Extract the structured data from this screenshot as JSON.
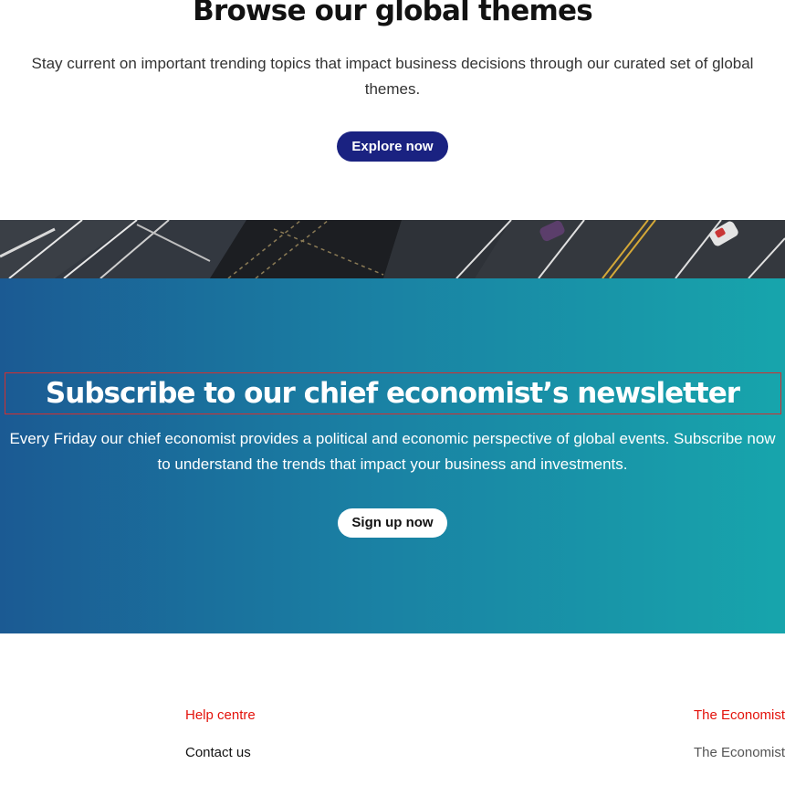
{
  "themes": {
    "title": "Browse our global themes",
    "description": "Stay current on important trending topics that impact business decisions through our curated set of global themes.",
    "button_label": "Explore now"
  },
  "newsletter": {
    "title": "Subscribe to our chief economist’s newsletter",
    "description": "Every Friday our chief economist provides a political and economic perspective of global events. Subscribe now to understand the trends that impact your business and investments.",
    "button_label": "Sign up now",
    "gradient_colors": [
      "#1b5a93",
      "#17a5ac"
    ]
  },
  "footer": {
    "columns": [
      {
        "heading": "Help centre",
        "links": [
          "Contact us"
        ]
      },
      {
        "heading": "The Economist",
        "links": [
          "The Economist"
        ]
      }
    ]
  },
  "colors": {
    "primary_button": "#1a2281",
    "footer_heading": "#e3120b"
  }
}
